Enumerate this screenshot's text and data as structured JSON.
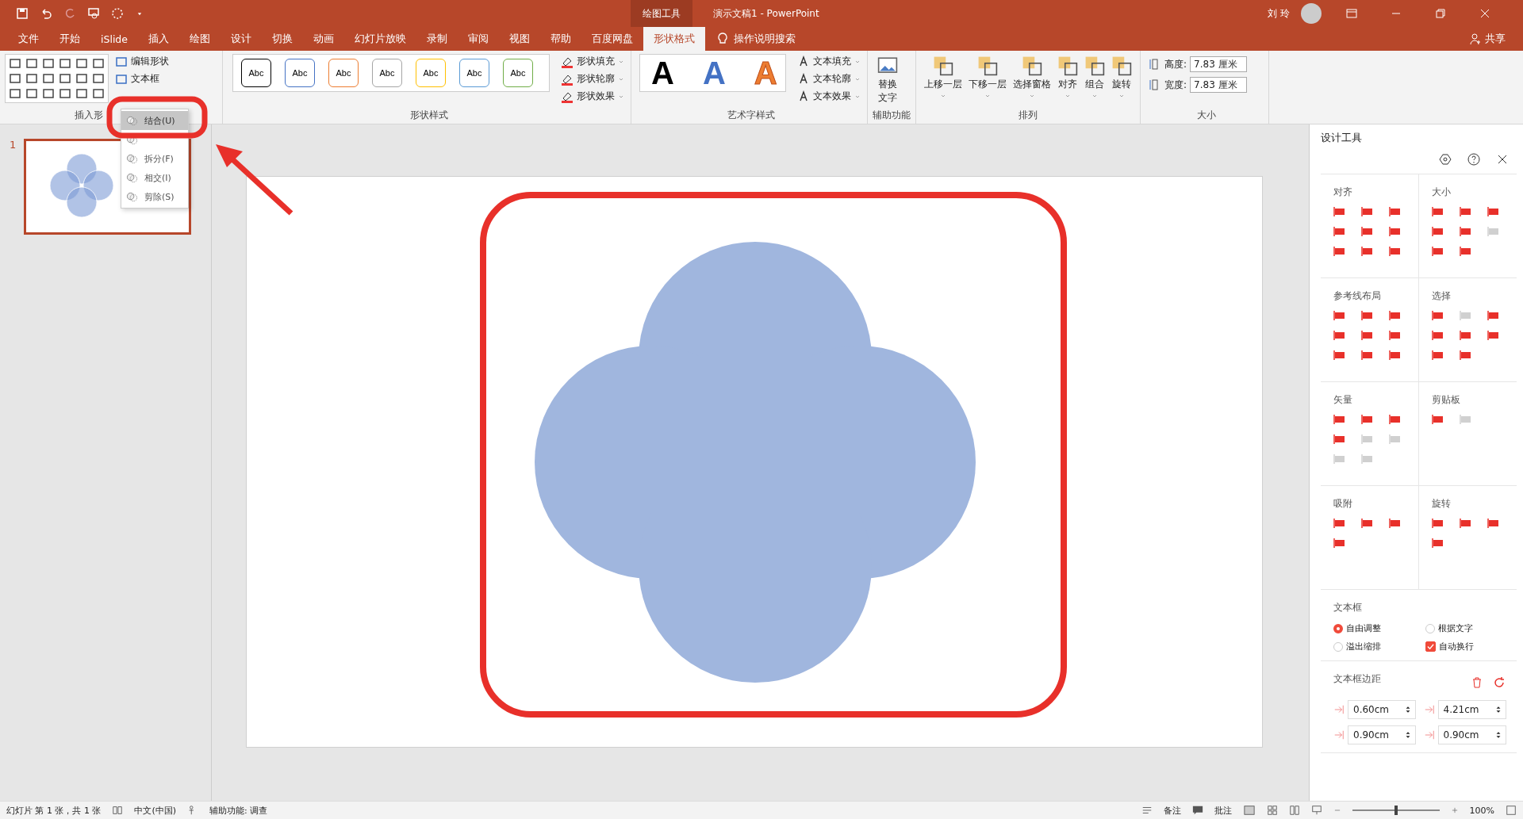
{
  "title_bar": {
    "contextual_tab": "绘图工具",
    "document_title": "演示文稿1  -  PowerPoint",
    "user_name": "刘 玲"
  },
  "tabs": [
    {
      "label": "文件",
      "selected": false
    },
    {
      "label": "开始",
      "selected": false
    },
    {
      "label": "iSlide",
      "selected": false
    },
    {
      "label": "插入",
      "selected": false
    },
    {
      "label": "绘图",
      "selected": false
    },
    {
      "label": "设计",
      "selected": false
    },
    {
      "label": "切换",
      "selected": false
    },
    {
      "label": "动画",
      "selected": false
    },
    {
      "label": "幻灯片放映",
      "selected": false
    },
    {
      "label": "录制",
      "selected": false
    },
    {
      "label": "审阅",
      "selected": false
    },
    {
      "label": "视图",
      "selected": false
    },
    {
      "label": "帮助",
      "selected": false
    },
    {
      "label": "百度网盘",
      "selected": false
    },
    {
      "label": "形状格式",
      "selected": true
    }
  ],
  "tell_me": "操作说明搜索",
  "share": "共享",
  "insert_shapes": {
    "label": "插入形",
    "buttons": [
      "编辑形状",
      "文本框"
    ]
  },
  "shape_styles": {
    "label": "形状样式",
    "swatches": [
      {
        "text": "Abc",
        "color": "#000000"
      },
      {
        "text": "Abc",
        "color": "#4472c4"
      },
      {
        "text": "Abc",
        "color": "#ed7d31"
      },
      {
        "text": "Abc",
        "color": "#a5a5a5"
      },
      {
        "text": "Abc",
        "color": "#ffc000"
      },
      {
        "text": "Abc",
        "color": "#5b9bd5"
      },
      {
        "text": "Abc",
        "color": "#70ad47"
      }
    ],
    "commands": [
      "形状填充",
      "形状轮廓",
      "形状效果"
    ]
  },
  "wordart_styles": {
    "label": "艺术字样式",
    "samples": [
      {
        "text": "A",
        "kind": "solid",
        "color": "#000000"
      },
      {
        "text": "A",
        "kind": "solid",
        "color": "#4472c4"
      },
      {
        "text": "A",
        "kind": "outline",
        "color": "#ed7d31"
      }
    ],
    "commands": [
      "文本填充",
      "文本轮廓",
      "文本效果"
    ]
  },
  "accessibility": {
    "label": "辅助功能",
    "button": "替换文字"
  },
  "arrange": {
    "label": "排列",
    "buttons": [
      "上移一层",
      "下移一层",
      "选择窗格",
      "对齐",
      "组合",
      "旋转"
    ]
  },
  "size": {
    "label": "大小",
    "fields": [
      {
        "label": "高度:",
        "value": "7.83 厘米"
      },
      {
        "label": "宽度:",
        "value": "7.83 厘米"
      }
    ]
  },
  "merge_menu": {
    "items": [
      {
        "label": "结合(U)",
        "selected": true
      },
      {
        "selected": false
      },
      {
        "label": "拆分(F)",
        "selected": false
      },
      {
        "label": "相交(I)",
        "selected": false
      },
      {
        "label": "剪除(S)",
        "selected": false
      }
    ]
  },
  "slides": [
    {
      "number": "1",
      "selected": true
    }
  ],
  "design_panel": {
    "title": "设计工具",
    "sections": [
      {
        "title": "对齐",
        "tools": [
          {
            "disabled": false
          },
          {
            "disabled": false
          },
          {
            "disabled": false
          },
          {
            "disabled": false
          },
          {
            "disabled": false
          },
          {
            "disabled": false
          },
          {
            "disabled": false
          },
          {
            "disabled": false
          },
          {
            "disabled": false
          }
        ]
      },
      {
        "title": "大小",
        "tools": [
          {
            "disabled": false
          },
          {
            "disabled": false
          },
          {
            "disabled": false
          },
          {
            "disabled": false
          },
          {
            "disabled": false
          },
          {
            "disabled": true
          },
          {
            "disabled": false
          },
          {
            "disabled": false
          }
        ]
      },
      {
        "title": "参考线布局",
        "tools": [
          {
            "disabled": false
          },
          {
            "disabled": false
          },
          {
            "disabled": false
          },
          {
            "disabled": false
          },
          {
            "disabled": false
          },
          {
            "disabled": false
          },
          {
            "disabled": false
          },
          {
            "disabled": false
          },
          {
            "disabled": false
          }
        ]
      },
      {
        "title": "选择",
        "tools": [
          {
            "disabled": false
          },
          {
            "disabled": true
          },
          {
            "disabled": false
          },
          {
            "disabled": false
          },
          {
            "disabled": false
          },
          {
            "disabled": false
          },
          {
            "disabled": false
          },
          {
            "disabled": false
          }
        ]
      },
      {
        "title": "矢量",
        "tools": [
          {
            "disabled": false
          },
          {
            "disabled": false
          },
          {
            "disabled": false
          },
          {
            "disabled": false
          },
          {
            "disabled": true
          },
          {
            "disabled": true
          },
          {
            "disabled": true
          },
          {
            "disabled": true
          }
        ]
      },
      {
        "title": "剪贴板",
        "tools": [
          {
            "disabled": false
          },
          {
            "disabled": true
          }
        ]
      },
      {
        "title": "吸附",
        "tools": [
          {
            "disabled": false
          },
          {
            "disabled": false
          },
          {
            "disabled": false
          },
          {
            "disabled": false
          }
        ]
      },
      {
        "title": "旋转",
        "tools": [
          {
            "disabled": false
          },
          {
            "disabled": false
          },
          {
            "disabled": false
          },
          {
            "disabled": false
          }
        ]
      }
    ],
    "textbox": {
      "title": "文本框",
      "options": [
        {
          "kind": "radio",
          "label": "自由调整",
          "selected": true
        },
        {
          "kind": "radio",
          "label": "根据文字",
          "selected": false
        },
        {
          "kind": "radio",
          "label": "溢出缩排",
          "selected": false
        },
        {
          "kind": "checkbox",
          "label": "自动换行",
          "checked": true
        }
      ]
    },
    "margins": {
      "title": "文本框边距",
      "fields": [
        {
          "value": "0.60cm"
        },
        {
          "value": "4.21cm"
        },
        {
          "value": "0.90cm"
        },
        {
          "value": "0.90cm"
        }
      ]
    }
  },
  "status_bar": {
    "slide_info": "幻灯片 第 1 张，共 1 张",
    "language": "中文(中国)",
    "accessibility": "辅助功能: 调查",
    "notes": "备注",
    "comments": "批注",
    "zoom": {
      "level": 0.5
    },
    "zoom_text": "100%"
  }
}
